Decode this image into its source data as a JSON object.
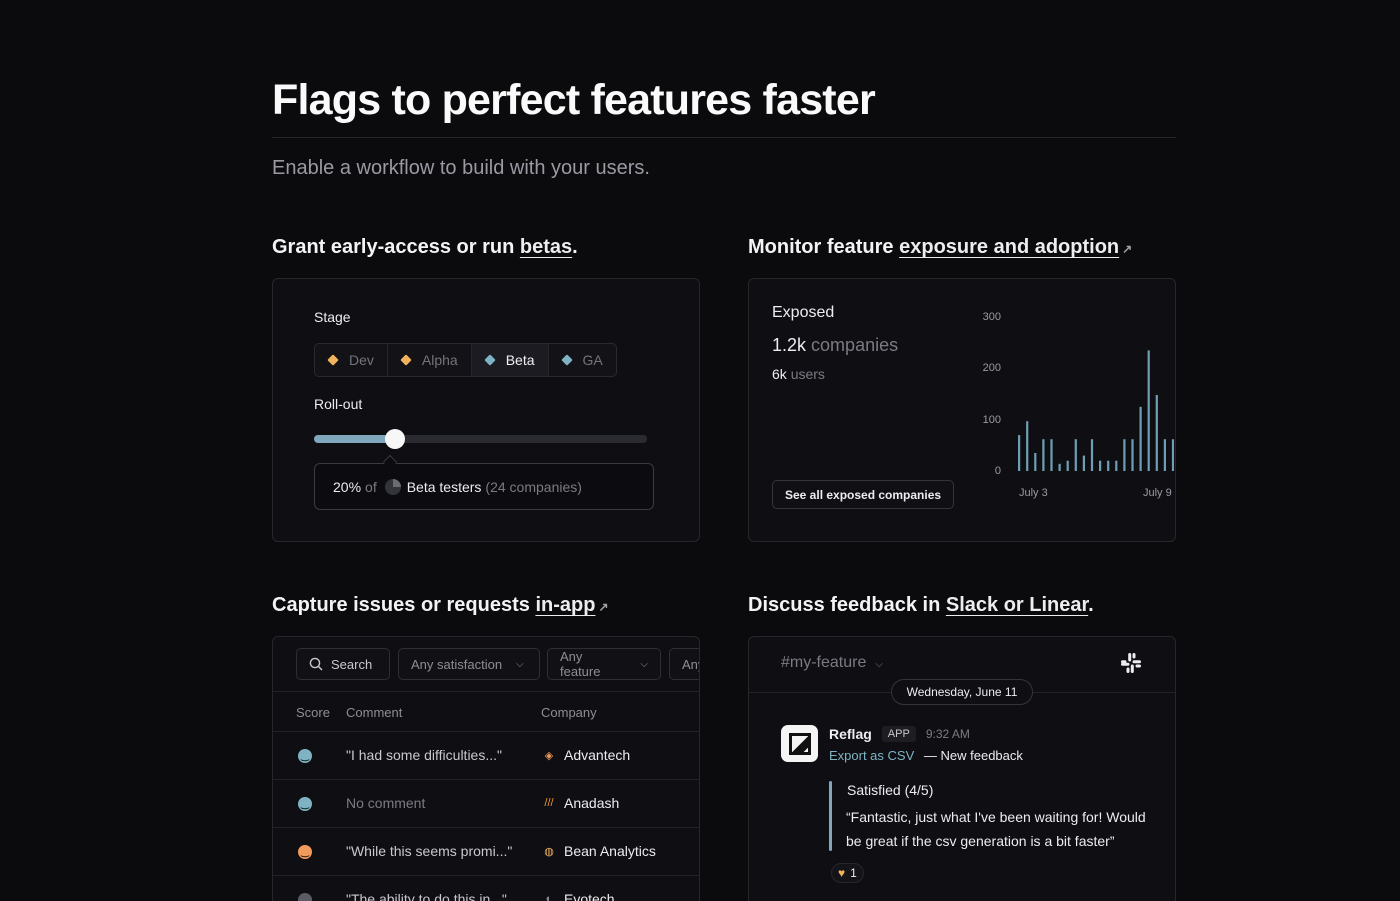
{
  "hero": {
    "title": "Flags to perfect features faster",
    "subtitle": "Enable a workflow to build with your users."
  },
  "sections": {
    "beta": {
      "prefix": "Grant early-access or run ",
      "link": "betas",
      "suffix": "."
    },
    "monitor": {
      "prefix": "Monitor feature ",
      "link": "exposure and adoption",
      "arrow": "↗"
    },
    "capture": {
      "prefix": "Capture issues or requests ",
      "link": "in-app",
      "arrow": "↗"
    },
    "discuss": {
      "prefix": "Discuss feedback in ",
      "link": "Slack or Linear",
      "suffix": "."
    }
  },
  "stage_card": {
    "stage_label": "Stage",
    "stages": [
      {
        "label": "Dev",
        "color": "#f2b25c"
      },
      {
        "label": "Alpha",
        "color": "#f2b25c"
      },
      {
        "label": "Beta",
        "color": "#7fb3c4"
      },
      {
        "label": "GA",
        "color": "#7fb3c4"
      }
    ],
    "active_stage": "Beta",
    "rollout_label": "Roll-out",
    "rollout_percent": 20,
    "callout": {
      "percent": "20%",
      "of": "of",
      "segment": "Beta testers",
      "companies": "(24 companies)"
    }
  },
  "exposure_card": {
    "title": "Exposed",
    "companies_value": "1.2k",
    "companies_label": "companies",
    "users_value": "6k",
    "users_label": "users",
    "button_label": "See all exposed companies"
  },
  "chart_data": {
    "type": "bar",
    "title": "",
    "xlabel": "",
    "ylabel": "",
    "ylim": [
      0,
      300
    ],
    "yticks": [
      "300",
      "200",
      "100",
      "0"
    ],
    "xticks": [
      "July 3",
      "July 9"
    ],
    "values": [
      70,
      97,
      35,
      62,
      62,
      14,
      20,
      62,
      30,
      62,
      20,
      20,
      20,
      62,
      62,
      125,
      235,
      148,
      62,
      62
    ],
    "bar_color": "#6e9fb3",
    "grid": false
  },
  "feedback_card": {
    "filters": {
      "search_label": "Search",
      "satisfaction": "Any satisfaction",
      "feature": "Any feature",
      "more": "Any"
    },
    "columns": [
      "Score",
      "Comment",
      "Company"
    ],
    "rows": [
      {
        "face_color": "#7fb3c4",
        "comment": "\"I had some difficulties...\"",
        "company": "Advantech",
        "icon_color": "#f29a5c"
      },
      {
        "face_color": "#7fb3c4",
        "comment": "No comment",
        "company": "Anadash",
        "icon_color": "#f29a2c"
      },
      {
        "face_color": "#f29a5c",
        "comment": "\"While this seems promi...\"",
        "company": "Bean Analytics",
        "icon_color": "#f2b25c"
      },
      {
        "face_color": "#5c5c66",
        "comment": "\"The ability to do this in...\"",
        "company": "Evotech",
        "icon_color": "#8d8d95"
      }
    ]
  },
  "slack_card": {
    "channel": "#my-feature",
    "date": "Wednesday, June 11",
    "sender": "Reflag",
    "badge": "APP",
    "time": "9:32 AM",
    "export_link": "Export as CSV",
    "export_suffix": "— New feedback",
    "satisfaction": "Satisfied (4/5)",
    "quote": "“Fantastic, just what I've been waiting for! Would be great if the csv generation is a bit faster”",
    "reaction_count": "1"
  }
}
